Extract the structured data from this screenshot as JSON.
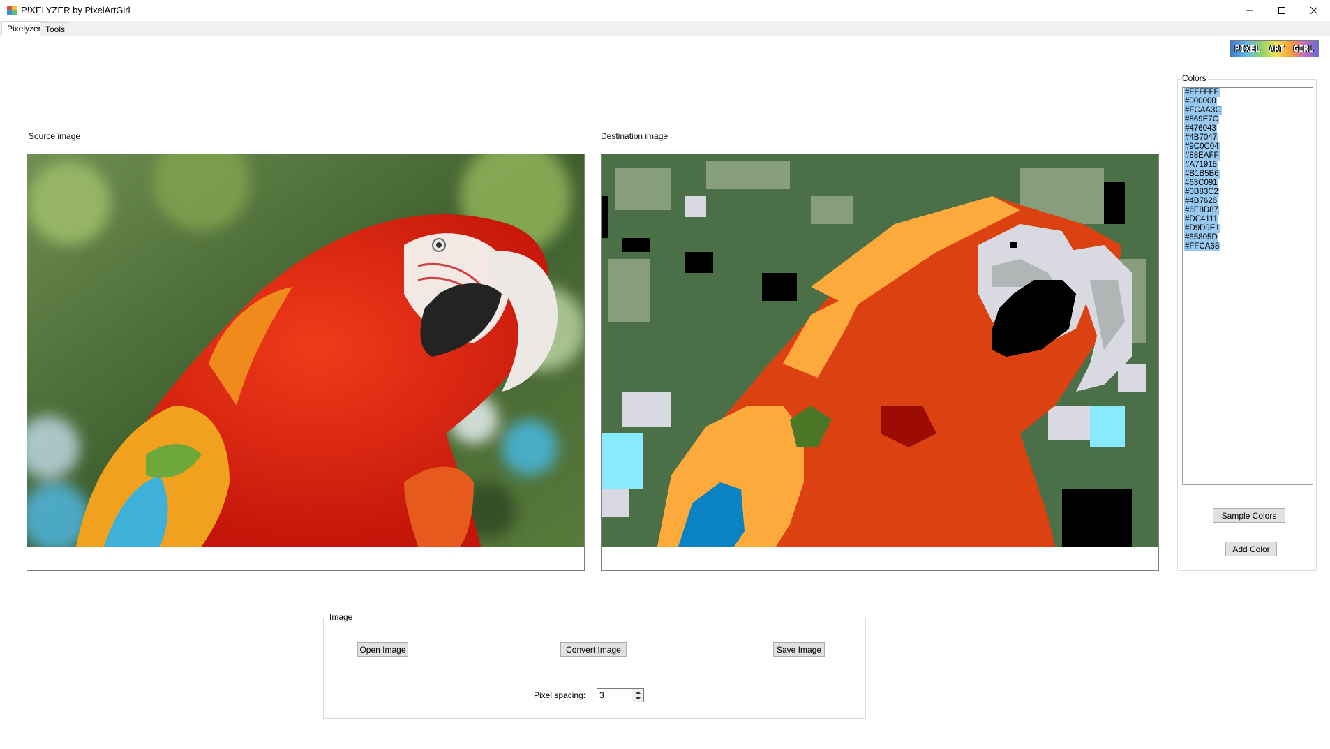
{
  "window": {
    "title": "P!XELYZER by PixelArtGirl",
    "icon": "app-icon",
    "controls": [
      "minimize-icon",
      "maximize-icon",
      "close-icon"
    ]
  },
  "tabs": [
    {
      "label": "Pixelyzer",
      "active": true
    },
    {
      "label": "Tools",
      "active": false
    }
  ],
  "logo": {
    "text": [
      "PIXEL",
      "ART",
      "GIRL"
    ]
  },
  "source": {
    "label": "Source image"
  },
  "destination": {
    "label": "Destination image"
  },
  "colors": {
    "group_label": "Colors",
    "items": [
      "#FFFFFF",
      "#000000",
      "#FCAA3C",
      "#869E7C",
      "#476043",
      "#4B7047",
      "#9C0C04",
      "#88EAFF",
      "#A71915",
      "#B1B5B6",
      "#63C091",
      "#0B83C2",
      "#4B7626",
      "#6E8D87",
      "#DC4111",
      "#D9D9E1",
      "#65805D",
      "#FFCA68"
    ],
    "sample_button": "Sample Colors",
    "add_button": "Add Color"
  },
  "image_group": {
    "label": "Image",
    "open_button": "Open Image",
    "convert_button": "Convert Image",
    "save_button": "Save Image",
    "pixel_spacing_label": "Pixel spacing:",
    "pixel_spacing_value": "3"
  }
}
